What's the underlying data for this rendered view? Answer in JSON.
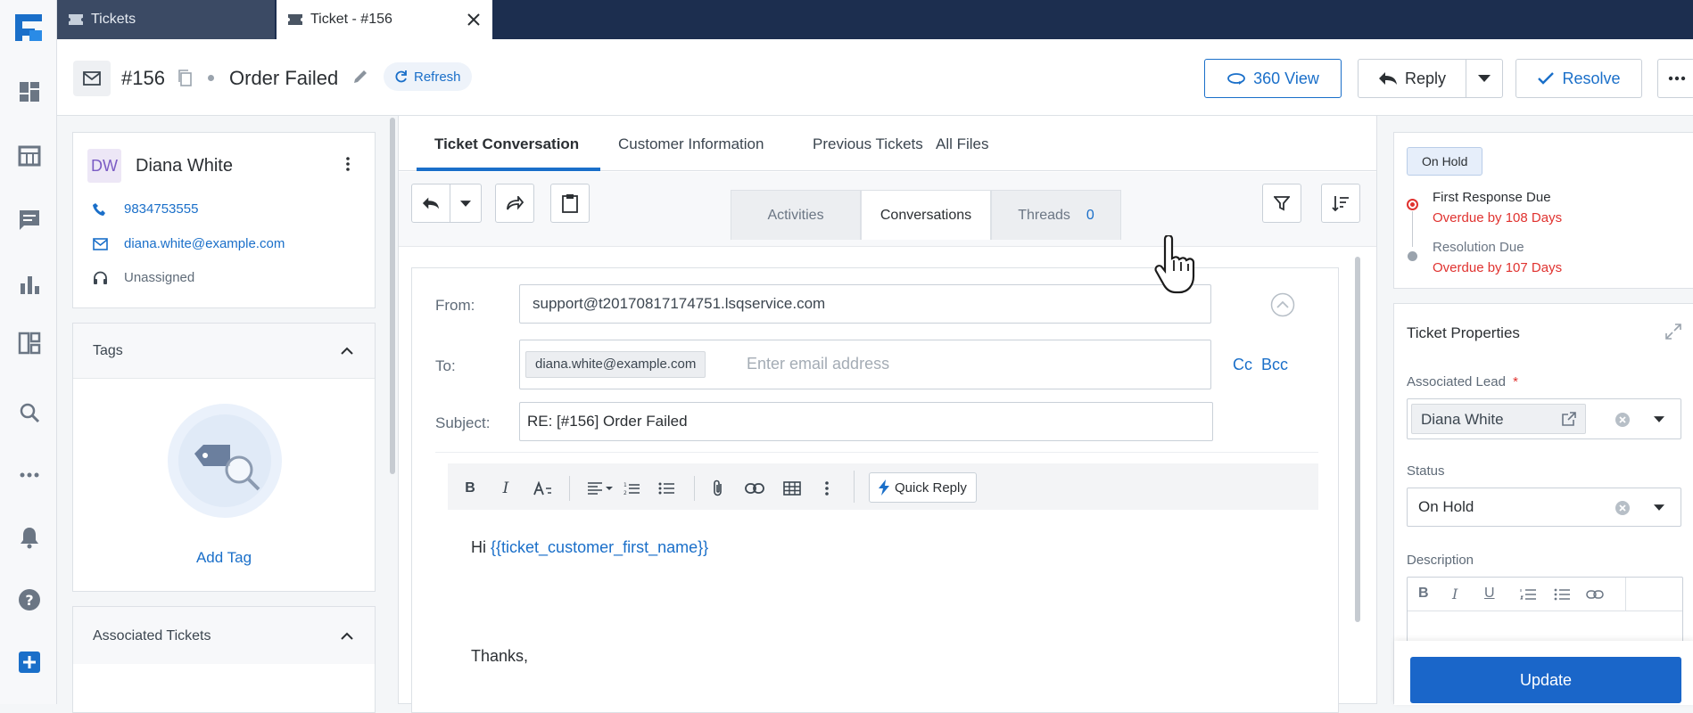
{
  "tabs": {
    "tickets": "Tickets",
    "ticket": "Ticket - #156"
  },
  "header": {
    "ticket_no": "#156",
    "title": "Order Failed",
    "refresh": "Refresh",
    "view360": "360 View",
    "reply": "Reply",
    "resolve": "Resolve"
  },
  "contact": {
    "initials": "DW",
    "name": "Diana White",
    "phone": "9834753555",
    "email": "diana.white@example.com",
    "owner": "Unassigned"
  },
  "tags": {
    "title": "Tags",
    "add": "Add Tag"
  },
  "assoc": {
    "title": "Associated Tickets"
  },
  "main_tabs": [
    "Ticket Conversation",
    "Customer Information",
    "Previous Tickets",
    "All Files"
  ],
  "sub_tabs": {
    "activities": "Activities",
    "conversations": "Conversations",
    "threads": "Threads",
    "threads_count": "0"
  },
  "email": {
    "from_label": "From:",
    "from_value": "support@t20170817174751.lsqservice.com",
    "to_label": "To:",
    "to_chip": "diana.white@example.com",
    "to_placeholder": "Enter email address",
    "cc": "Cc",
    "bcc": "Bcc",
    "subject_label": "Subject:",
    "subject_value": "RE: [#156] Order Failed",
    "quick_reply": "Quick Reply",
    "body_hi": "Hi",
    "body_var": "{{ticket_customer_first_name}}",
    "body_thanks": "Thanks,"
  },
  "sla": {
    "status_badge": "On Hold",
    "first_label": "First Response Due",
    "first_value": "Overdue by 108 Days",
    "resolution_label": "Resolution Due",
    "resolution_value": "Overdue by 107 Days"
  },
  "props": {
    "title": "Ticket Properties",
    "lead_label": "Associated Lead",
    "required_mark": "*",
    "lead_value": "Diana White",
    "status_label": "Status",
    "status_value": "On Hold",
    "desc_label": "Description",
    "update": "Update"
  },
  "colors": {
    "accent": "#1a6fc9",
    "navy": "#1c2e4f",
    "overdue": "#e0322f",
    "update_btn": "#1a66c9"
  }
}
